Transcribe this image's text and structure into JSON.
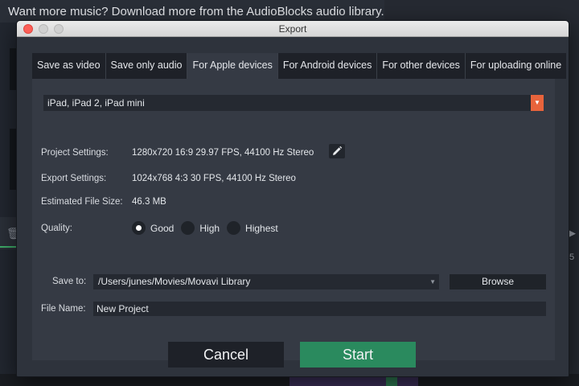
{
  "background": {
    "banner_text": "Want more music? Download more from the AudioBlocks audio library.",
    "right_label": "5"
  },
  "window": {
    "title": "Export"
  },
  "tabs": [
    {
      "label": "Save as video",
      "active": false
    },
    {
      "label": "Save only audio",
      "active": false
    },
    {
      "label": "For Apple devices",
      "active": true
    },
    {
      "label": "For Android devices",
      "active": false
    },
    {
      "label": "For other devices",
      "active": false
    },
    {
      "label": "For uploading online",
      "active": false
    }
  ],
  "device": {
    "selected": "iPad, iPad 2, iPad mini"
  },
  "project_settings": {
    "label": "Project Settings:",
    "value": "1280x720 16:9 29.97 FPS, 44100 Hz Stereo"
  },
  "export_settings": {
    "label": "Export Settings:",
    "value": "1024x768 4:3 30 FPS, 44100 Hz Stereo"
  },
  "file_size": {
    "label": "Estimated File Size:",
    "value": "46.3 MB"
  },
  "quality": {
    "label": "Quality:",
    "options": [
      {
        "label": "Good",
        "checked": true
      },
      {
        "label": "High",
        "checked": false
      },
      {
        "label": "Highest",
        "checked": false
      }
    ]
  },
  "save_to": {
    "label": "Save to:",
    "path": "/Users/junes/Movies/Movavi Library",
    "browse_label": "Browse"
  },
  "file_name": {
    "label": "File Name:",
    "value": "New Project"
  },
  "actions": {
    "cancel_label": "Cancel",
    "start_label": "Start"
  },
  "colors": {
    "accent_orange": "#e8643c",
    "start_green": "#2a8a5e",
    "close_red": "#fc5f57"
  }
}
